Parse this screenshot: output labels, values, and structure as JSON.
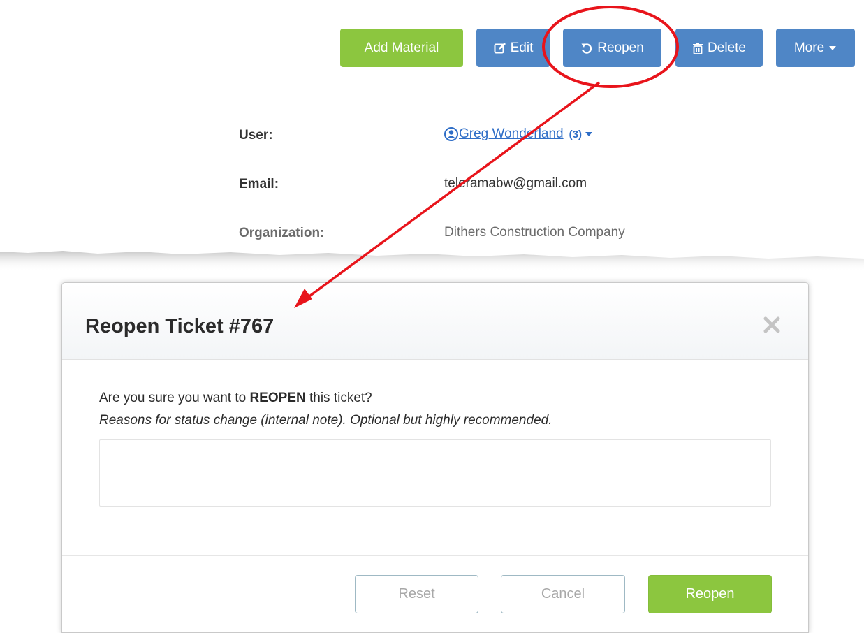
{
  "toolbar": {
    "add_material": "Add Material",
    "edit": "Edit",
    "reopen": "Reopen",
    "delete": "Delete",
    "more": "More"
  },
  "ticket_info": {
    "user_label": "User:",
    "user_name": "Greg Wonderland",
    "user_count": "(3)",
    "email_label": "Email:",
    "email_value": "teleramabw@gmail.com",
    "org_label": "Organization:",
    "org_value": "Dithers Construction Company"
  },
  "modal": {
    "title": "Reopen Ticket #767",
    "question_prefix": "Are you sure you want to ",
    "question_emphasis": "REOPEN",
    "question_suffix": " this ticket?",
    "hint": "Reasons for status change (internal note). Optional but highly recommended.",
    "note_value": "",
    "reset": "Reset",
    "cancel": "Cancel",
    "confirm": "Reopen"
  },
  "icons": {
    "edit": "edit-icon",
    "reopen": "undo-icon",
    "delete": "trash-icon",
    "more": "caret-down-icon",
    "user": "user-circle-icon",
    "close": "close-icon"
  },
  "colors": {
    "green": "#8cc63f",
    "blue": "#4f86c6",
    "link": "#2f6ec7",
    "annotation_red": "#e8141b"
  }
}
